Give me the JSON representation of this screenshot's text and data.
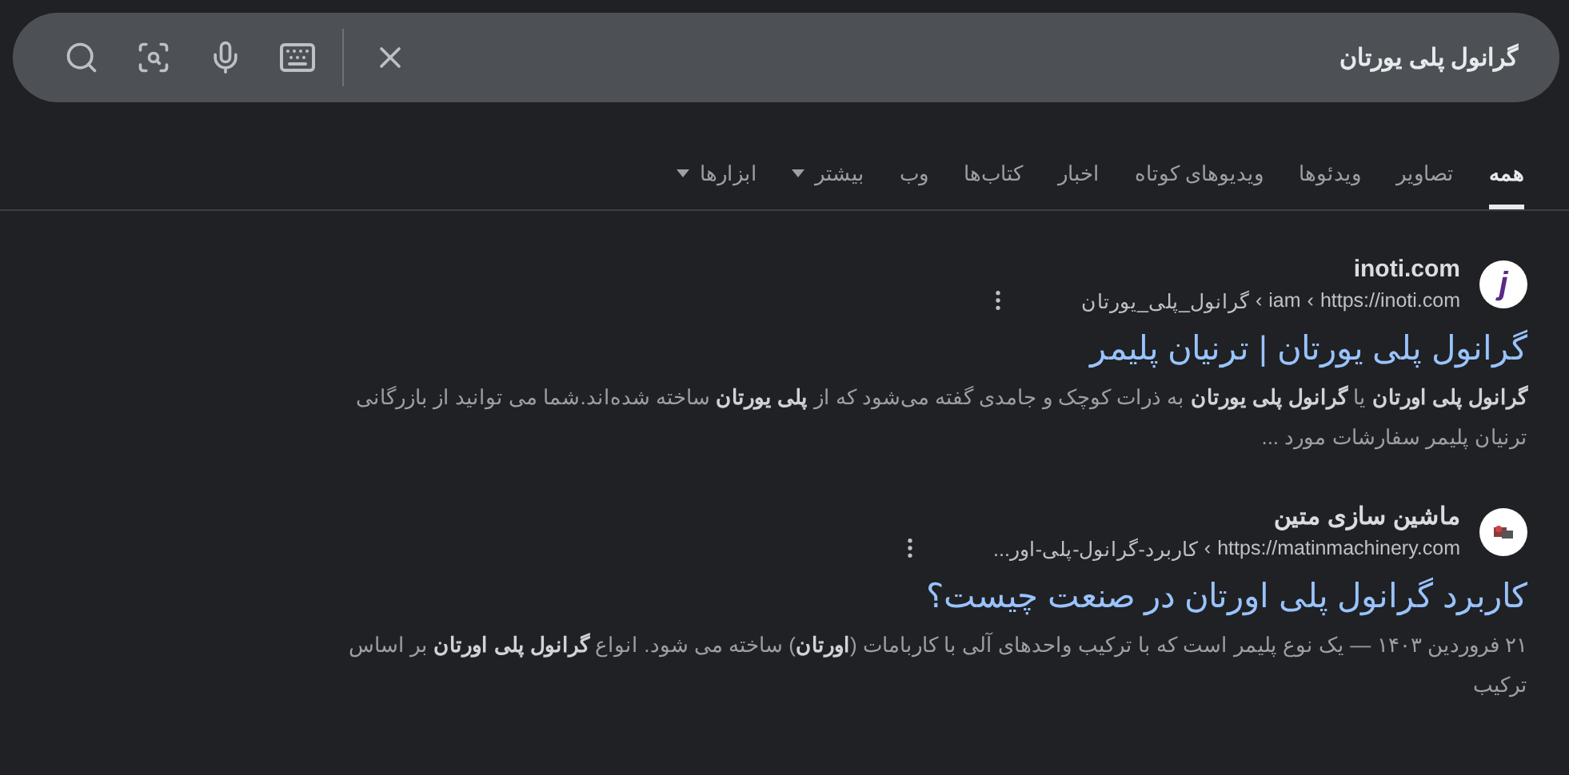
{
  "search": {
    "value": "گرانول پلی یورتان"
  },
  "tabs": [
    {
      "label": "همه",
      "selected": true,
      "has_menu": false
    },
    {
      "label": "تصاویر",
      "selected": false,
      "has_menu": false
    },
    {
      "label": "ویدئوها",
      "selected": false,
      "has_menu": false
    },
    {
      "label": "ویدیوهای کوتاه",
      "selected": false,
      "has_menu": false
    },
    {
      "label": "اخبار",
      "selected": false,
      "has_menu": false
    },
    {
      "label": "کتاب‌ها",
      "selected": false,
      "has_menu": false
    },
    {
      "label": "وب",
      "selected": false,
      "has_menu": false
    },
    {
      "label": "بیشتر",
      "selected": false,
      "has_menu": true
    },
    {
      "label": "ابزارها",
      "selected": false,
      "has_menu": true
    }
  ],
  "results": [
    {
      "site": "inoti.com",
      "favicon": {
        "kind": "letter",
        "text": "j"
      },
      "breadcrumb": [
        {
          "text": "https://inoti.com"
        },
        {
          "separator": "›",
          "text": "iam"
        },
        {
          "separator": "›",
          "text": "گرانول_پلی_یورتان"
        }
      ],
      "title": "گرانول پلی یورتان | ترنیان پلیمر",
      "snippet": "**گرانول پلی اورتان** یا **گرانول پلی یورتان** به ذرات کوچک و جامدی گفته می‌شود که از **پلی یورتان** ساخته شده‌اند.شما می توانید از بازرگانی ترنیان پلیمر سفارشات مورد ..."
    },
    {
      "site": "ماشین سازی متین",
      "favicon": {
        "kind": "picture"
      },
      "breadcrumb": [
        {
          "text": "https://matinmachinery.com"
        },
        {
          "separator": "›",
          "text": "کاربرد-گرانول-پلی-اور..."
        }
      ],
      "title": "کاربرد گرانول پلی اورتان در صنعت چیست؟",
      "date": "۲۱ فروردین ۱۴۰۳ —",
      "snippet": "یک نوع پلیمر است که با ترکیب واحدهای آلی با کاربامات (**اورتان**) ساخته می شود. انواع **گرانول پلی اورتان** بر اساس ترکیب"
    }
  ]
}
